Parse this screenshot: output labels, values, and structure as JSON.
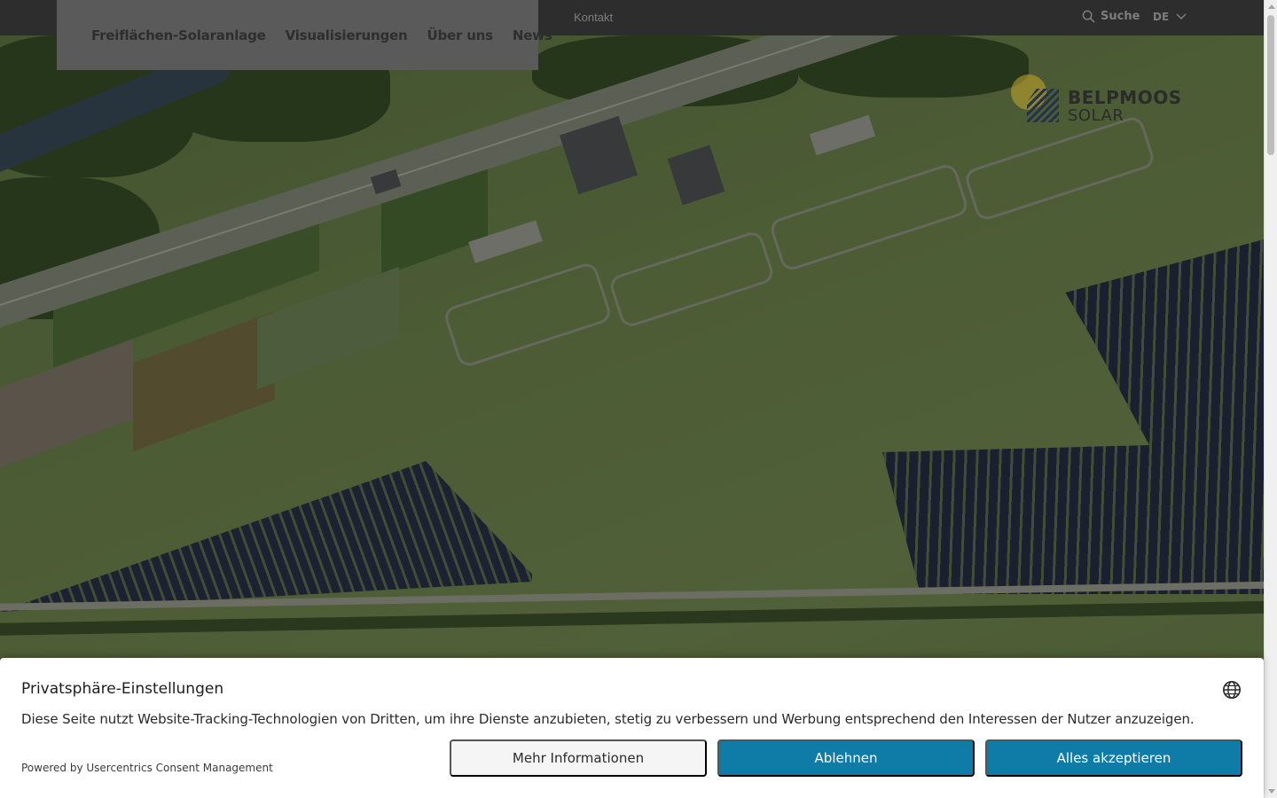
{
  "topbar": {
    "kontakt": "Kontakt",
    "search_label": "Suche",
    "search_icon": "search-icon",
    "language": "DE",
    "language_icon": "chevron-down-icon"
  },
  "nav": {
    "items": [
      {
        "label": "Freiflächen-Solaranlage"
      },
      {
        "label": "Visualisierungen"
      },
      {
        "label": "Über uns"
      },
      {
        "label": "News"
      }
    ]
  },
  "logo": {
    "line1": "BELPMOOS",
    "line2": "SOLAR"
  },
  "consent": {
    "title": "Privatsphäre-Einstellungen",
    "description": "Diese Seite nutzt Website-Tracking-Technologien von Dritten, um ihre Dienste anzubieten, stetig zu verbessern und Werbung entsprechend den Interessen der Nutzer anzuzeigen.",
    "powered_by": "Powered by Usercentrics Consent Management",
    "more_info": "Mehr Informationen",
    "deny": "Ablehnen",
    "accept_all": "Alles akzeptieren",
    "language_icon": "globe-icon"
  },
  "colors": {
    "accent": "#0e7ca6",
    "topbar_bg": "#2d2d2d",
    "nav_bg": "#5a5a5a",
    "logo_sun": "#c9a82a",
    "logo_stripes": "#2e4b6e"
  }
}
